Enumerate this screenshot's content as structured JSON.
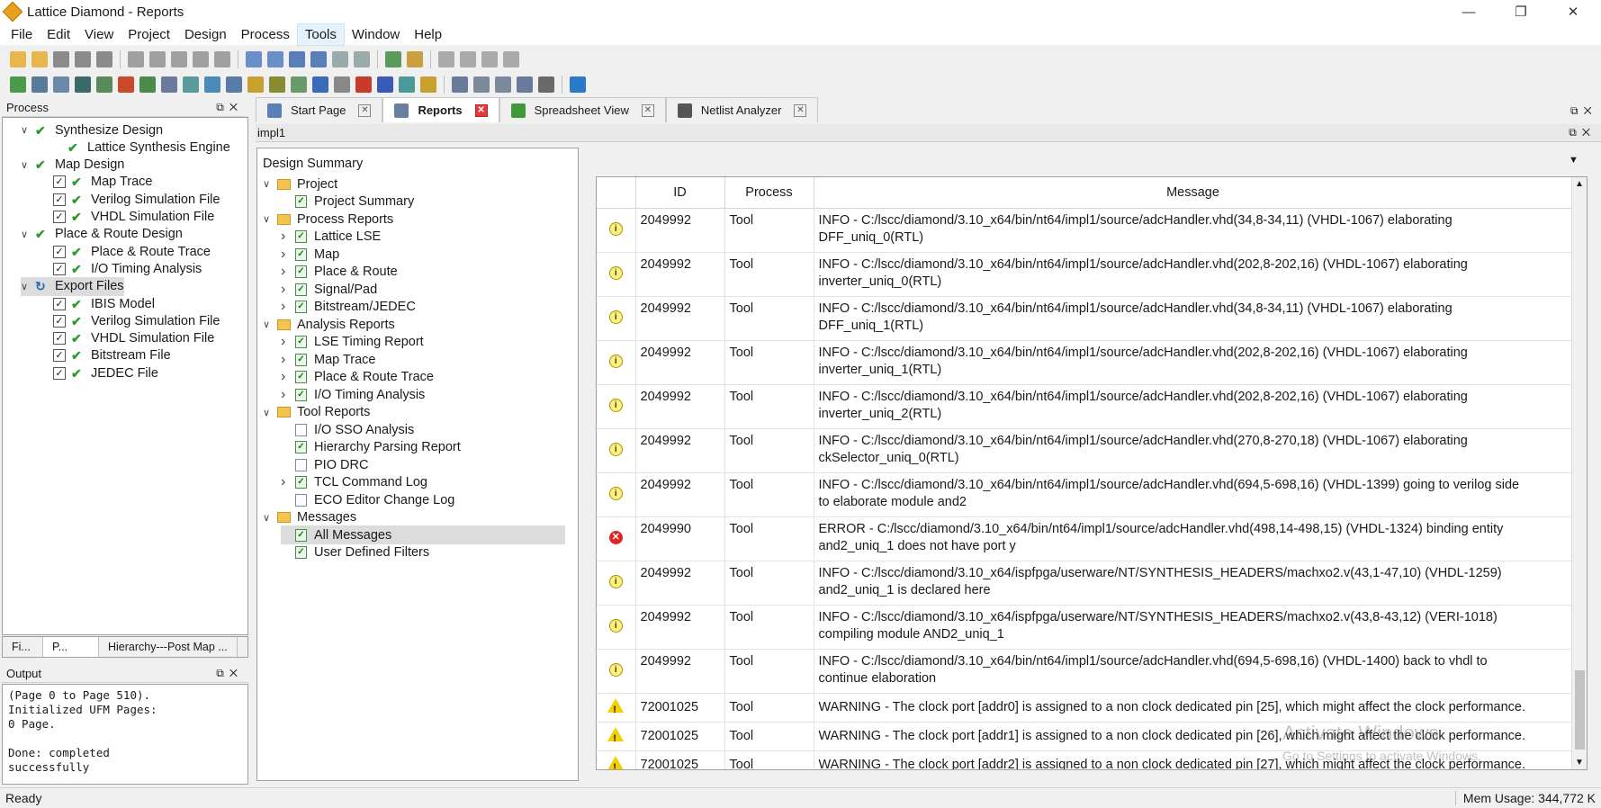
{
  "window": {
    "title": "Lattice Diamond - Reports",
    "minimize": "—",
    "maximize": "❐",
    "close": "✕"
  },
  "menu": [
    "File",
    "Edit",
    "View",
    "Project",
    "Design",
    "Process",
    "Tools",
    "Window",
    "Help"
  ],
  "menu_active": "Tools",
  "process_panel": {
    "title": "Process",
    "items": [
      {
        "label": "Synthesize Design",
        "indent": 0,
        "type": "group"
      },
      {
        "label": "Lattice Synthesis Engine",
        "indent": 1,
        "type": "green"
      },
      {
        "label": "Map Design",
        "indent": 0,
        "type": "group"
      },
      {
        "label": "Map Trace",
        "indent": 1,
        "type": "check"
      },
      {
        "label": "Verilog Simulation File",
        "indent": 1,
        "type": "check"
      },
      {
        "label": "VHDL Simulation File",
        "indent": 1,
        "type": "check"
      },
      {
        "label": "Place & Route Design",
        "indent": 0,
        "type": "group"
      },
      {
        "label": "Place & Route Trace",
        "indent": 1,
        "type": "check"
      },
      {
        "label": "I/O Timing Analysis",
        "indent": 1,
        "type": "check"
      },
      {
        "label": "Export Files",
        "indent": 0,
        "type": "group-sel"
      },
      {
        "label": "IBIS Model",
        "indent": 1,
        "type": "check"
      },
      {
        "label": "Verilog Simulation File",
        "indent": 1,
        "type": "check"
      },
      {
        "label": "VHDL Simulation File",
        "indent": 1,
        "type": "check"
      },
      {
        "label": "Bitstream File",
        "indent": 1,
        "type": "check"
      },
      {
        "label": "JEDEC File",
        "indent": 1,
        "type": "check"
      }
    ]
  },
  "bottom_tabs": [
    "Fi...",
    "P...",
    "Hierarchy---Post Map ..."
  ],
  "output": {
    "title": "Output",
    "text": "(Page 0 to Page 510).\nInitialized UFM Pages:\n0 Page.\n\nDone: completed\nsuccessfully"
  },
  "tabs": [
    {
      "label": "Start Page",
      "color": "#5b7fb8"
    },
    {
      "label": "Reports",
      "color": "#6a7fa0"
    },
    {
      "label": "Spreadsheet View",
      "color": "#3c9a3c"
    },
    {
      "label": "Netlist Analyzer",
      "color": "#555555"
    }
  ],
  "active_tab": "Reports",
  "impl": "impl1",
  "report_tree": {
    "title": "Design Summary",
    "items": [
      {
        "label": "Project",
        "kind": "folder",
        "indent": 0,
        "exp": "v"
      },
      {
        "label": "Project Summary",
        "kind": "report",
        "indent": 1,
        "exp": ""
      },
      {
        "label": "Process Reports",
        "kind": "folder",
        "indent": 0,
        "exp": "v"
      },
      {
        "label": "Lattice LSE",
        "kind": "report",
        "indent": 1,
        "exp": ">"
      },
      {
        "label": "Map",
        "kind": "report",
        "indent": 1,
        "exp": ">"
      },
      {
        "label": "Place & Route",
        "kind": "report",
        "indent": 1,
        "exp": ">"
      },
      {
        "label": "Signal/Pad",
        "kind": "report",
        "indent": 1,
        "exp": ">"
      },
      {
        "label": "Bitstream/JEDEC",
        "kind": "report",
        "indent": 1,
        "exp": ">"
      },
      {
        "label": "Analysis Reports",
        "kind": "folder",
        "indent": 0,
        "exp": "v"
      },
      {
        "label": "LSE Timing Report",
        "kind": "report",
        "indent": 1,
        "exp": ">"
      },
      {
        "label": "Map Trace",
        "kind": "report",
        "indent": 1,
        "exp": ">"
      },
      {
        "label": "Place & Route Trace",
        "kind": "report",
        "indent": 1,
        "exp": ">"
      },
      {
        "label": "I/O Timing Analysis",
        "kind": "report",
        "indent": 1,
        "exp": ">"
      },
      {
        "label": "Tool Reports",
        "kind": "folder",
        "indent": 0,
        "exp": "v"
      },
      {
        "label": "I/O SSO Analysis",
        "kind": "doc",
        "indent": 1,
        "exp": ""
      },
      {
        "label": "Hierarchy Parsing Report",
        "kind": "report",
        "indent": 1,
        "exp": ""
      },
      {
        "label": "PIO DRC",
        "kind": "doc",
        "indent": 1,
        "exp": ""
      },
      {
        "label": "TCL Command Log",
        "kind": "report",
        "indent": 1,
        "exp": ">"
      },
      {
        "label": "ECO Editor Change Log",
        "kind": "doc",
        "indent": 1,
        "exp": ""
      },
      {
        "label": "Messages",
        "kind": "folder",
        "indent": 0,
        "exp": "v"
      },
      {
        "label": "All Messages",
        "kind": "report",
        "indent": 1,
        "exp": "",
        "selected": true
      },
      {
        "label": "User Defined Filters",
        "kind": "report",
        "indent": 1,
        "exp": ""
      }
    ]
  },
  "messages": {
    "columns": [
      "",
      "ID",
      "Process",
      "Message"
    ],
    "rows": [
      {
        "sev": "info",
        "id": "2049992",
        "process": "Tool",
        "msg1": "INFO - C:/lscc/diamond/3.10_x64/bin/nt64/impl1/source/adcHandler.vhd(34,8-34,11) (VHDL-1067) elaborating",
        "msg2": "DFF_uniq_0(RTL)"
      },
      {
        "sev": "info",
        "id": "2049992",
        "process": "Tool",
        "msg1": "INFO - C:/lscc/diamond/3.10_x64/bin/nt64/impl1/source/adcHandler.vhd(202,8-202,16) (VHDL-1067) elaborating",
        "msg2": "inverter_uniq_0(RTL)"
      },
      {
        "sev": "info",
        "id": "2049992",
        "process": "Tool",
        "msg1": "INFO - C:/lscc/diamond/3.10_x64/bin/nt64/impl1/source/adcHandler.vhd(34,8-34,11) (VHDL-1067) elaborating",
        "msg2": "DFF_uniq_1(RTL)"
      },
      {
        "sev": "info",
        "id": "2049992",
        "process": "Tool",
        "msg1": "INFO - C:/lscc/diamond/3.10_x64/bin/nt64/impl1/source/adcHandler.vhd(202,8-202,16) (VHDL-1067) elaborating",
        "msg2": "inverter_uniq_1(RTL)"
      },
      {
        "sev": "info",
        "id": "2049992",
        "process": "Tool",
        "msg1": "INFO - C:/lscc/diamond/3.10_x64/bin/nt64/impl1/source/adcHandler.vhd(202,8-202,16) (VHDL-1067) elaborating",
        "msg2": "inverter_uniq_2(RTL)"
      },
      {
        "sev": "info",
        "id": "2049992",
        "process": "Tool",
        "msg1": "INFO - C:/lscc/diamond/3.10_x64/bin/nt64/impl1/source/adcHandler.vhd(270,8-270,18) (VHDL-1067) elaborating",
        "msg2": "ckSelector_uniq_0(RTL)"
      },
      {
        "sev": "info",
        "id": "2049992",
        "process": "Tool",
        "msg1": "INFO - C:/lscc/diamond/3.10_x64/bin/nt64/impl1/source/adcHandler.vhd(694,5-698,16) (VHDL-1399) going to verilog side",
        "msg2": "to elaborate module and2"
      },
      {
        "sev": "error",
        "id": "2049990",
        "process": "Tool",
        "msg1": "ERROR - C:/lscc/diamond/3.10_x64/bin/nt64/impl1/source/adcHandler.vhd(498,14-498,15) (VHDL-1324) binding entity",
        "msg2": "and2_uniq_1 does not have port y"
      },
      {
        "sev": "info",
        "id": "2049992",
        "process": "Tool",
        "msg1": "INFO - C:/lscc/diamond/3.10_x64/ispfpga/userware/NT/SYNTHESIS_HEADERS/machxo2.v(43,1-47,10) (VHDL-1259)",
        "msg2": "and2_uniq_1 is declared here"
      },
      {
        "sev": "info",
        "id": "2049992",
        "process": "Tool",
        "msg1": "INFO - C:/lscc/diamond/3.10_x64/ispfpga/userware/NT/SYNTHESIS_HEADERS/machxo2.v(43,8-43,12) (VERI-1018)",
        "msg2": "compiling module AND2_uniq_1"
      },
      {
        "sev": "info",
        "id": "2049992",
        "process": "Tool",
        "msg1": "INFO - C:/lscc/diamond/3.10_x64/bin/nt64/impl1/source/adcHandler.vhd(694,5-698,16) (VHDL-1400) back to vhdl to",
        "msg2": "continue elaboration"
      },
      {
        "sev": "warn",
        "id": "72001025",
        "process": "Tool",
        "msg1": "WARNING - The clock port [addr0] is assigned to a non clock dedicated pin [25], which might affect the clock performance.",
        "msg2": ""
      },
      {
        "sev": "warn",
        "id": "72001025",
        "process": "Tool",
        "msg1": "WARNING - The clock port [addr1] is assigned to a non clock dedicated pin [26], which might affect the clock performance.",
        "msg2": ""
      },
      {
        "sev": "warn",
        "id": "72001025",
        "process": "Tool",
        "msg1": "WARNING - The clock port [addr2] is assigned to a non clock dedicated pin [27], which might affect the clock performance.",
        "msg2": ""
      }
    ]
  },
  "watermark": {
    "line1": "Activate Windows",
    "line2": "Go to Settings to activate Windows."
  },
  "status": {
    "left": "Ready",
    "right": "Mem Usage:  344,772 K"
  }
}
